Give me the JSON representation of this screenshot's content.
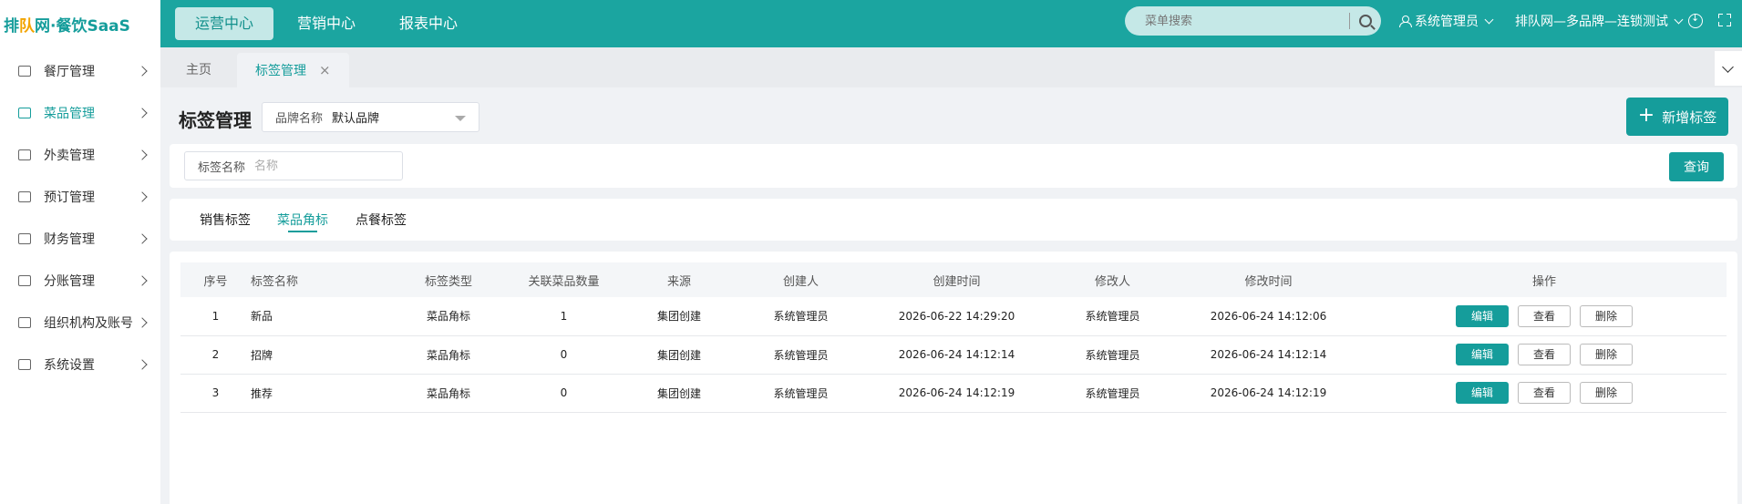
{
  "logo": {
    "part1": "排",
    "accent": "队",
    "part2": "网·餐饮SaaS"
  },
  "nav": [
    {
      "label": "运营中心",
      "active": true
    },
    {
      "label": "营销中心",
      "active": false
    },
    {
      "label": "报表中心",
      "active": false
    }
  ],
  "search": {
    "placeholder": "菜单搜索"
  },
  "user": {
    "name": "系统管理员"
  },
  "brand_selector": {
    "label": "排队网—多品牌—连锁测试"
  },
  "sidebar": {
    "items": [
      {
        "label": "餐厅管理",
        "icon": "store-icon"
      },
      {
        "label": "菜品管理",
        "icon": "dish-icon",
        "active": true
      },
      {
        "label": "外卖管理",
        "icon": "takeout-icon"
      },
      {
        "label": "预订管理",
        "icon": "reservation-icon"
      },
      {
        "label": "财务管理",
        "icon": "finance-icon"
      },
      {
        "label": "分账管理",
        "icon": "split-icon"
      },
      {
        "label": "组织机构及账号",
        "icon": "org-icon"
      },
      {
        "label": "系统设置",
        "icon": "settings-icon"
      }
    ]
  },
  "tabs": [
    {
      "label": "主页"
    },
    {
      "label": "标签管理",
      "active": true
    }
  ],
  "page": {
    "title": "标签管理",
    "brand_field_label": "品牌名称",
    "brand_field_value": "默认品牌",
    "new_button": "新增标签"
  },
  "filter": {
    "label": "标签名称",
    "placeholder": "名称",
    "query_button": "查询"
  },
  "subtabs": [
    {
      "label": "销售标签"
    },
    {
      "label": "菜品角标",
      "active": true
    },
    {
      "label": "点餐标签"
    }
  ],
  "table": {
    "headers": [
      "序号",
      "标签名称",
      "标签类型",
      "关联菜品数量",
      "来源",
      "创建人",
      "创建时间",
      "修改人",
      "修改时间",
      "操作"
    ],
    "rows": [
      {
        "seq": "1",
        "name": "新品",
        "type": "菜品角标",
        "count": "1",
        "source": "集团创建",
        "creator": "系统管理员",
        "created": "2026-06-22 14:29:20",
        "modifier": "系统管理员",
        "modified": "2026-06-24 14:12:06"
      },
      {
        "seq": "2",
        "name": "招牌",
        "type": "菜品角标",
        "count": "0",
        "source": "集团创建",
        "creator": "系统管理员",
        "created": "2026-06-24 14:12:14",
        "modifier": "系统管理员",
        "modified": "2026-06-24 14:12:14"
      },
      {
        "seq": "3",
        "name": "推荐",
        "type": "菜品角标",
        "count": "0",
        "source": "集团创建",
        "creator": "系统管理员",
        "created": "2026-06-24 14:12:19",
        "modifier": "系统管理员",
        "modified": "2026-06-24 14:12:19"
      }
    ],
    "actions": {
      "edit": "编辑",
      "view": "查看",
      "delete": "删除"
    }
  },
  "colors": {
    "brand": "#159d9b",
    "topbar": "#1ba5a0",
    "logo_accent": "#f2a400"
  }
}
